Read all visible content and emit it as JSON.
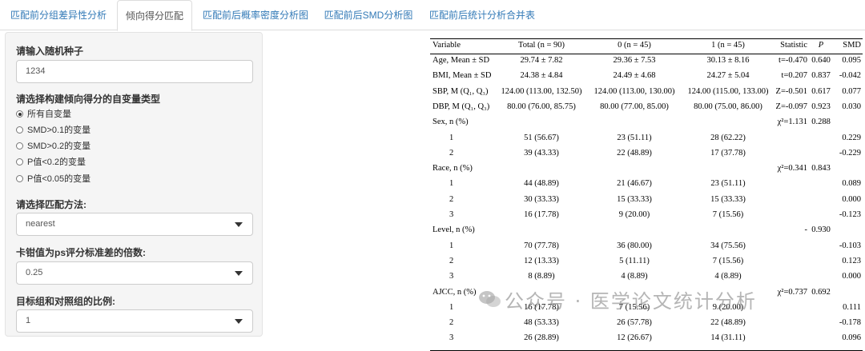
{
  "tabs": [
    {
      "label": "匹配前分组差异性分析"
    },
    {
      "label": "倾向得分匹配"
    },
    {
      "label": "匹配前后概率密度分析图"
    },
    {
      "label": "匹配前后SMD分析图"
    },
    {
      "label": "匹配前后统计分析合并表"
    }
  ],
  "sidebar": {
    "seed_label": "请输入随机种子",
    "seed_value": "1234",
    "vartype_label": "请选择构建倾向得分的自变量类型",
    "vartype_options": [
      "所有自变量",
      "SMD>0.1的变量",
      "SMD>0.2的变量",
      "P值<0.2的变量",
      "P值<0.05的变量"
    ],
    "method_label": "请选择匹配方法:",
    "method_value": "nearest",
    "caliper_label": "卡钳值为ps评分标准差的倍数:",
    "caliper_value": "0.25",
    "ratio_label": "目标组和对照组的比例:",
    "ratio_value": "1"
  },
  "table": {
    "headers": [
      "Variable",
      "Total (n = 90)",
      "0 (n = 45)",
      "1 (n = 45)",
      "Statistic",
      "P",
      "SMD"
    ],
    "rows": [
      [
        "Age, Mean ± SD",
        "29.74 ± 7.82",
        "29.36 ± 7.53",
        "30.13 ± 8.16",
        "t=-0.470",
        "0.640",
        "0.095"
      ],
      [
        "BMI, Mean ± SD",
        "24.38 ± 4.84",
        "24.49 ± 4.68",
        "24.27 ± 5.04",
        "t=0.207",
        "0.837",
        "-0.042"
      ],
      [
        "SBP, M (Q₁, Q₃)",
        "124.00 (113.00, 132.50)",
        "124.00 (113.00, 130.00)",
        "124.00 (115.00, 133.00)",
        "Z=-0.501",
        "0.617",
        "0.077"
      ],
      [
        "DBP, M (Q₁, Q₃)",
        "80.00 (76.00, 85.75)",
        "80.00 (77.00, 85.00)",
        "80.00 (75.00, 86.00)",
        "Z=-0.097",
        "0.923",
        "0.030"
      ],
      [
        "Sex, n (%)",
        "",
        "",
        "",
        "χ²=1.131",
        "0.288",
        ""
      ],
      [
        "1",
        "51 (56.67)",
        "23 (51.11)",
        "28 (62.22)",
        "",
        "",
        "0.229"
      ],
      [
        "2",
        "39 (43.33)",
        "22 (48.89)",
        "17 (37.78)",
        "",
        "",
        "-0.229"
      ],
      [
        "Race, n (%)",
        "",
        "",
        "",
        "χ²=0.341",
        "0.843",
        ""
      ],
      [
        "1",
        "44 (48.89)",
        "21 (46.67)",
        "23 (51.11)",
        "",
        "",
        "0.089"
      ],
      [
        "2",
        "30 (33.33)",
        "15 (33.33)",
        "15 (33.33)",
        "",
        "",
        "0.000"
      ],
      [
        "3",
        "16 (17.78)",
        "9 (20.00)",
        "7 (15.56)",
        "",
        "",
        "-0.123"
      ],
      [
        "Level, n (%)",
        "",
        "",
        "",
        "-",
        "0.930",
        ""
      ],
      [
        "1",
        "70 (77.78)",
        "36 (80.00)",
        "34 (75.56)",
        "",
        "",
        "-0.103"
      ],
      [
        "2",
        "12 (13.33)",
        "5 (11.11)",
        "7 (15.56)",
        "",
        "",
        "0.123"
      ],
      [
        "3",
        "8 (8.89)",
        "4 (8.89)",
        "4 (8.89)",
        "",
        "",
        "0.000"
      ],
      [
        "AJCC, n (%)",
        "",
        "",
        "",
        "χ²=0.737",
        "0.692",
        ""
      ],
      [
        "1",
        "16 (17.78)",
        "7 (15.56)",
        "9 (20.00)",
        "",
        "",
        "0.111"
      ],
      [
        "2",
        "48 (53.33)",
        "26 (57.78)",
        "22 (48.89)",
        "",
        "",
        "-0.178"
      ],
      [
        "3",
        "26 (28.89)",
        "12 (26.67)",
        "14 (31.11)",
        "",
        "",
        "0.096"
      ]
    ]
  },
  "watermark": {
    "text": "公众号 · 医学论文统计分析",
    "icon": "wechat-icon"
  }
}
